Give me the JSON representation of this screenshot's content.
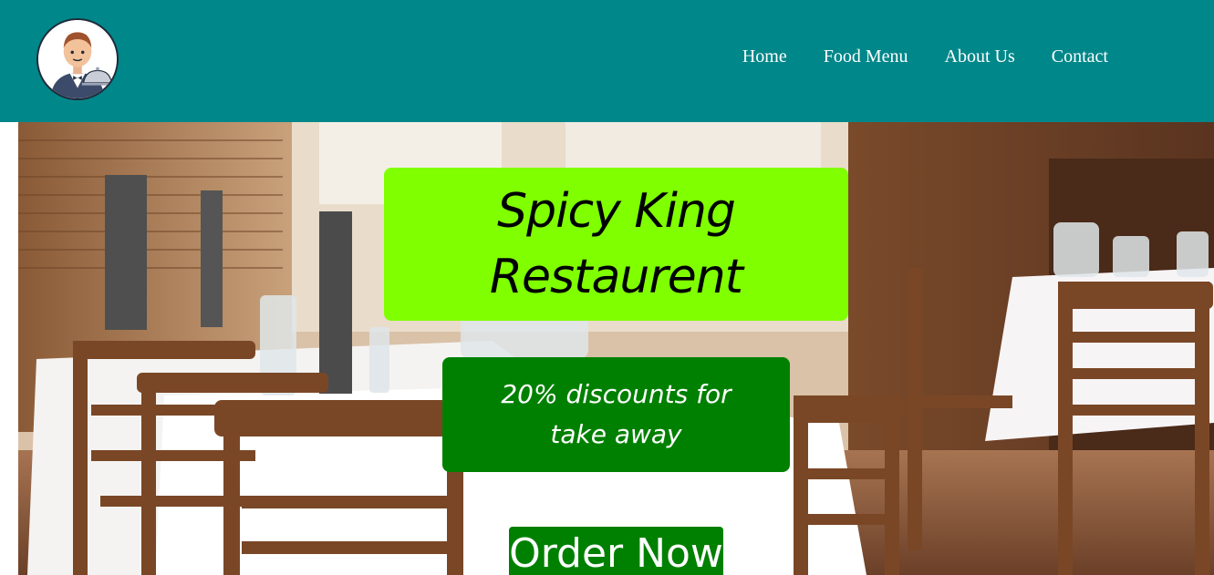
{
  "nav": {
    "items": [
      {
        "label": "Home"
      },
      {
        "label": "Food Menu"
      },
      {
        "label": "About Us"
      },
      {
        "label": "Contact"
      }
    ]
  },
  "hero": {
    "title": "Spicy King Restaurent",
    "promo": "20% discounts for take away",
    "cta_label": "Order Now"
  },
  "colors": {
    "header_bg": "#00878a",
    "title_bg": "#80ff00",
    "promo_bg": "#008000",
    "button_bg": "#008000"
  },
  "icons": {
    "logo": "waiter-avatar-icon"
  }
}
